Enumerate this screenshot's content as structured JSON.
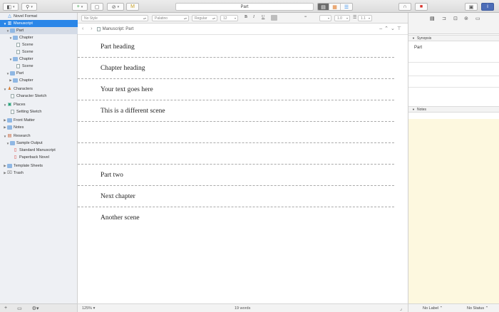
{
  "toolbar": {
    "doc_title": "Part",
    "binder_icon": "binder-toggle-icon",
    "quick_search_icon": "magnifier-icon",
    "add_icon": "plus-icon",
    "folder_icon": "folder-icon",
    "snapshot_icon": "attachment-icon",
    "compose_icon": "compose-icon",
    "view_modes": [
      "editor-mode-icon",
      "corkboard-icon",
      "outliner-icon"
    ],
    "right_buttons": [
      "compile-icon",
      "bookmark-icon",
      "collections-icon",
      "info-icon"
    ]
  },
  "binder": {
    "items": [
      {
        "label": "Novel Format",
        "icon": "triangle-icon",
        "depth": 0,
        "disclosure": "",
        "state": ""
      },
      {
        "label": "Manuscript",
        "icon": "manuscript-icon",
        "depth": 0,
        "disclosure": "▼",
        "state": "selected"
      },
      {
        "label": "Part",
        "icon": "folder-icon",
        "depth": 1,
        "disclosure": "▼",
        "state": "sub"
      },
      {
        "label": "Chapter",
        "icon": "folder-icon",
        "depth": 2,
        "disclosure": "▼",
        "state": ""
      },
      {
        "label": "Scene",
        "icon": "page-icon",
        "depth": 3,
        "disclosure": "",
        "state": ""
      },
      {
        "label": "Scene",
        "icon": "page-icon",
        "depth": 3,
        "disclosure": "",
        "state": ""
      },
      {
        "label": "Chapter",
        "icon": "folder-icon",
        "depth": 2,
        "disclosure": "▼",
        "state": ""
      },
      {
        "label": "Scene",
        "icon": "page-icon",
        "depth": 3,
        "disclosure": "",
        "state": ""
      },
      {
        "label": "Part",
        "icon": "folder-icon",
        "depth": 1,
        "disclosure": "▼",
        "state": ""
      },
      {
        "label": "Chapter",
        "icon": "folder-icon",
        "depth": 2,
        "disclosure": "▶",
        "state": ""
      },
      {
        "label": "Characters",
        "icon": "characters-icon",
        "depth": 0,
        "disclosure": "▼",
        "state": ""
      },
      {
        "label": "Character Sketch",
        "icon": "page-icon",
        "depth": 1,
        "disclosure": "",
        "state": ""
      },
      {
        "label": "Places",
        "icon": "places-icon",
        "depth": 0,
        "disclosure": "▼",
        "state": ""
      },
      {
        "label": "Setting Sketch",
        "icon": "page-icon",
        "depth": 1,
        "disclosure": "",
        "state": ""
      },
      {
        "label": "Front Matter",
        "icon": "folder-icon",
        "depth": 0,
        "disclosure": "▶",
        "state": ""
      },
      {
        "label": "Notes",
        "icon": "folder-icon",
        "depth": 0,
        "disclosure": "▶",
        "state": ""
      },
      {
        "label": "Research",
        "icon": "research-icon",
        "depth": 0,
        "disclosure": "▼",
        "state": ""
      },
      {
        "label": "Sample Output",
        "icon": "folder-icon",
        "depth": 1,
        "disclosure": "▼",
        "state": ""
      },
      {
        "label": "Standard Manuscript",
        "icon": "pdf-icon",
        "depth": 2,
        "disclosure": "",
        "state": ""
      },
      {
        "label": "Paperback Novel",
        "icon": "pdf-icon",
        "depth": 2,
        "disclosure": "",
        "state": ""
      },
      {
        "label": "Template Sheets",
        "icon": "folder-icon",
        "depth": 0,
        "disclosure": "▶",
        "state": ""
      },
      {
        "label": "Trash",
        "icon": "trash-icon",
        "depth": 0,
        "disclosure": "▶",
        "state": ""
      }
    ]
  },
  "formatbar": {
    "style": "No Style",
    "font": "Palatino",
    "weight": "Regular",
    "size": "12",
    "bold": "B",
    "italic": "I",
    "underline": "U",
    "line_spacing": "1.0",
    "list": "1.1"
  },
  "header": {
    "breadcrumb": "Manuscript: Part"
  },
  "editor": {
    "lines": [
      {
        "text": "Part heading"
      },
      {
        "text": "Chapter heading"
      },
      {
        "text": "Your text goes here"
      },
      {
        "text": "This is a different scene"
      },
      {
        "text": ""
      },
      {
        "text": ""
      },
      {
        "text": "Part two"
      },
      {
        "text": "Next chapter"
      },
      {
        "text": "Another scene"
      }
    ]
  },
  "footer": {
    "zoom": "125%",
    "word_count": "19 words"
  },
  "inspector": {
    "synopsis_title": "Synopsis",
    "synopsis_text": "Part",
    "notes_title": "Notes",
    "label": "No Label",
    "status": "No Status"
  },
  "colors": {
    "selection": "#2a86e8",
    "notes_bg": "#fdf8df",
    "binder_bg": "#eef0f4"
  }
}
